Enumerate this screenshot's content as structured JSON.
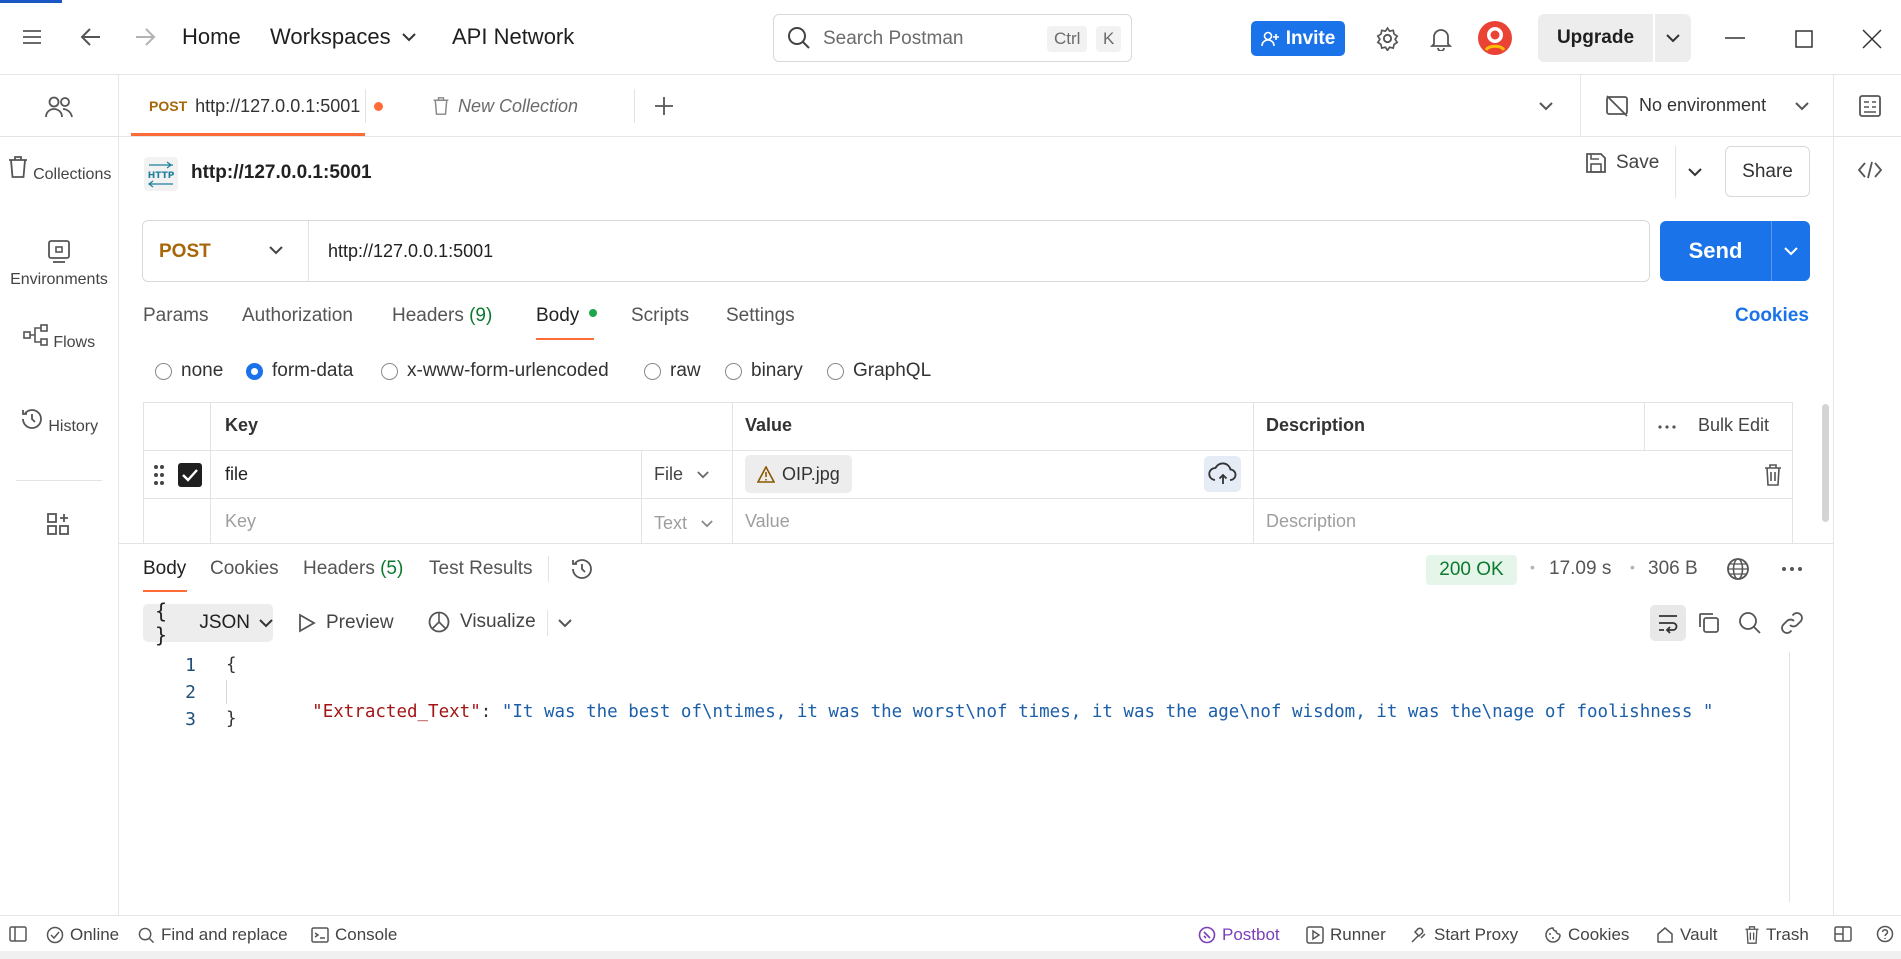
{
  "titlebar": {
    "nav": {
      "home": "Home",
      "workspaces": "Workspaces",
      "api_network": "API Network"
    },
    "search": {
      "placeholder": "Search Postman",
      "shortcut_ctrl": "Ctrl",
      "shortcut_key": "K"
    },
    "invite_label": "Invite",
    "upgrade_label": "Upgrade"
  },
  "sidebar": {
    "items": [
      {
        "label": "Collections",
        "icon": "trash-can-icon"
      },
      {
        "label": "Environments",
        "icon": "environment-icon"
      },
      {
        "label": "Flows",
        "icon": "flows-icon"
      },
      {
        "label": "History",
        "icon": "history-icon"
      }
    ]
  },
  "tabs": [
    {
      "method": "POST",
      "label": "http://127.0.0.1:5001",
      "unsaved": true
    },
    {
      "label": "New Collection"
    }
  ],
  "environment": {
    "selected": "No environment"
  },
  "request": {
    "name": "http://127.0.0.1:5001",
    "save_label": "Save",
    "share_label": "Share",
    "method": "POST",
    "url": "http://127.0.0.1:5001",
    "send_label": "Send",
    "tabs": [
      "Params",
      "Authorization",
      "Headers",
      "Body",
      "Scripts",
      "Settings"
    ],
    "headers_count": "(9)",
    "cookies_label": "Cookies",
    "body_types": [
      "none",
      "form-data",
      "x-www-form-urlencoded",
      "raw",
      "binary",
      "GraphQL"
    ],
    "selected_body_type": "form-data"
  },
  "formdata": {
    "columns": {
      "key": "Key",
      "value": "Value",
      "description": "Description"
    },
    "bulk_edit": "Bulk Edit",
    "rows": [
      {
        "key": "file",
        "type": "File",
        "value": "OIP.jpg",
        "checked": true
      }
    ],
    "placeholder": {
      "key": "Key",
      "type": "Text",
      "value": "Value",
      "description": "Description"
    }
  },
  "response": {
    "tabs": [
      "Body",
      "Cookies",
      "Headers",
      "Test Results"
    ],
    "headers_count": "(5)",
    "status": "200 OK",
    "time": "17.09 s",
    "size": "306 B",
    "format": "JSON",
    "preview_label": "Preview",
    "visualize_label": "Visualize",
    "lines": [
      "1",
      "2",
      "3"
    ],
    "code": {
      "open": "{",
      "key": "\"Extracted_Text\"",
      "colon": ": ",
      "value": "\"It was the best of\\ntimes, it was the worst\\nof times, it was the age\\nof wisdom, it was the\\nage of foolishness \"",
      "close": "}"
    }
  },
  "footer": {
    "online": "Online",
    "find_replace": "Find and replace",
    "console": "Console",
    "postbot": "Postbot",
    "runner": "Runner",
    "start_proxy": "Start Proxy",
    "cookies": "Cookies",
    "vault": "Vault",
    "trash": "Trash"
  },
  "colors": {
    "accent_blue": "#1a73e8",
    "method_post": "#a8660b",
    "tab_indicator": "#ff6c37",
    "status_ok": "#0c7a2e",
    "json_key": "#a31515",
    "json_value": "#1c5ea8"
  }
}
